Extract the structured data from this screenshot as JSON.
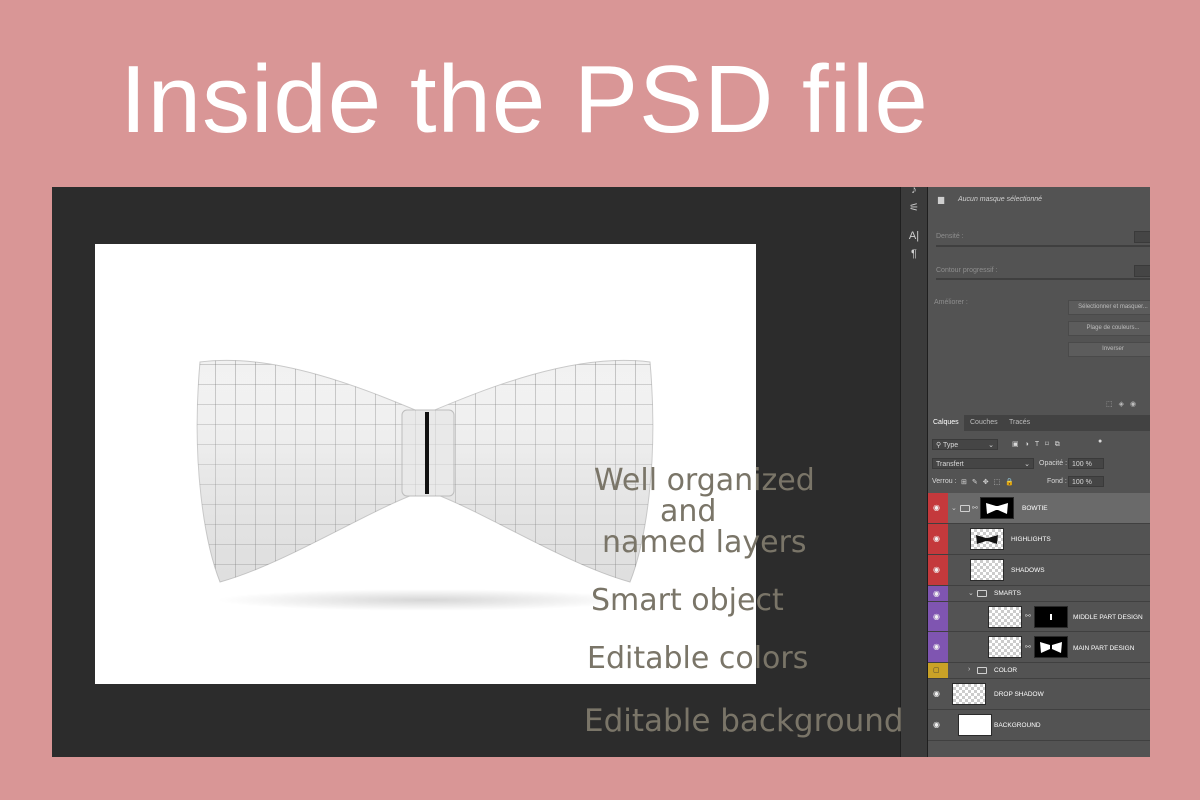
{
  "headline": "Inside the PSD file",
  "features": {
    "line1": "Well organized",
    "line2": "and",
    "line3": "named layers",
    "smart": "Smart object",
    "colors": "Editable colors",
    "background": "Editable background"
  },
  "properties": {
    "title": "Aucun masque sélectionné",
    "density_label": "Densité :",
    "feather_label": "Contour progressif :",
    "refine_label": "Améliorer :",
    "btn_select_mask": "Sélectionner et masquer...",
    "btn_color_range": "Plage de couleurs...",
    "btn_invert": "Inverser"
  },
  "layers_panel": {
    "tabs": [
      "Calques",
      "Couches",
      "Tracés"
    ],
    "filter_value": "Type",
    "blend_mode": "Transfert",
    "opacity_label": "Opacité :",
    "opacity_value": "100 %",
    "lock_label": "Verrou :",
    "fill_label": "Fond :",
    "fill_value": "100 %",
    "layers": [
      {
        "name": "BOWTIE",
        "tag": "#c4393c"
      },
      {
        "name": "HIGHLIGHTS",
        "tag": "#c4393c"
      },
      {
        "name": "SHADOWS",
        "tag": "#c4393c"
      },
      {
        "name": "SMARTS",
        "tag": "#7f55b1"
      },
      {
        "name": "MIDDLE PART DESIGN",
        "tag": "#7f55b1"
      },
      {
        "name": "MAIN PART DESIGN",
        "tag": "#7f55b1"
      },
      {
        "name": "COLOR",
        "tag": "#c9a227"
      },
      {
        "name": "DROP SHADOW",
        "tag": ""
      },
      {
        "name": "BACKGROUND",
        "tag": ""
      }
    ]
  },
  "colors": {
    "page_bg": "#d99696",
    "headline": "#ffffff",
    "feature_text": "#7a7568",
    "tag_red": "#c4393c",
    "tag_violet": "#7f55b1",
    "tag_yellow": "#c9a227"
  }
}
